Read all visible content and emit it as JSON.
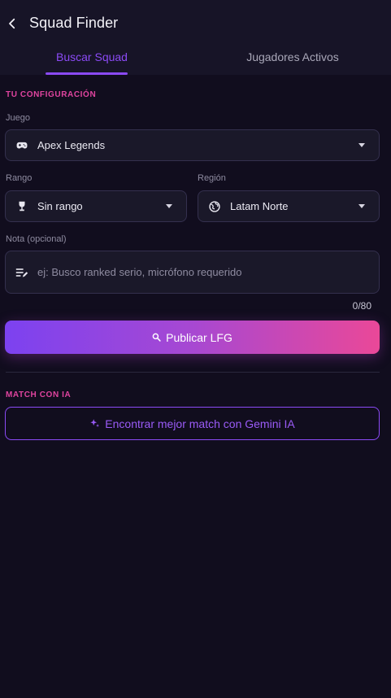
{
  "header": {
    "title": "Squad Finder"
  },
  "tabs": [
    {
      "label": "Buscar Squad",
      "active": true
    },
    {
      "label": "Jugadores Activos",
      "active": false
    }
  ],
  "config": {
    "section_label": "TU CONFIGURACIÓN",
    "game": {
      "label": "Juego",
      "value": "Apex Legends",
      "icon": "gamepad-icon"
    },
    "rank": {
      "label": "Rango",
      "value": "Sin rango",
      "icon": "trophy-icon"
    },
    "region": {
      "label": "Región",
      "value": "Latam Norte",
      "icon": "globe-icon"
    },
    "note": {
      "label": "Nota (opcional)",
      "placeholder": "ej: Busco ranked serio, micrófono requerido",
      "counter": "0/80",
      "icon": "edit-note-icon"
    },
    "publish_label": "Publicar LFG"
  },
  "ai_match": {
    "section_label": "MATCH CON IA",
    "button_label": "Encontrar mejor match con Gemini IA"
  },
  "colors": {
    "background": "#110d1e",
    "accent_purple": "#8b4af5",
    "accent_pink": "#e0449f",
    "field_bg": "#1a1829"
  }
}
